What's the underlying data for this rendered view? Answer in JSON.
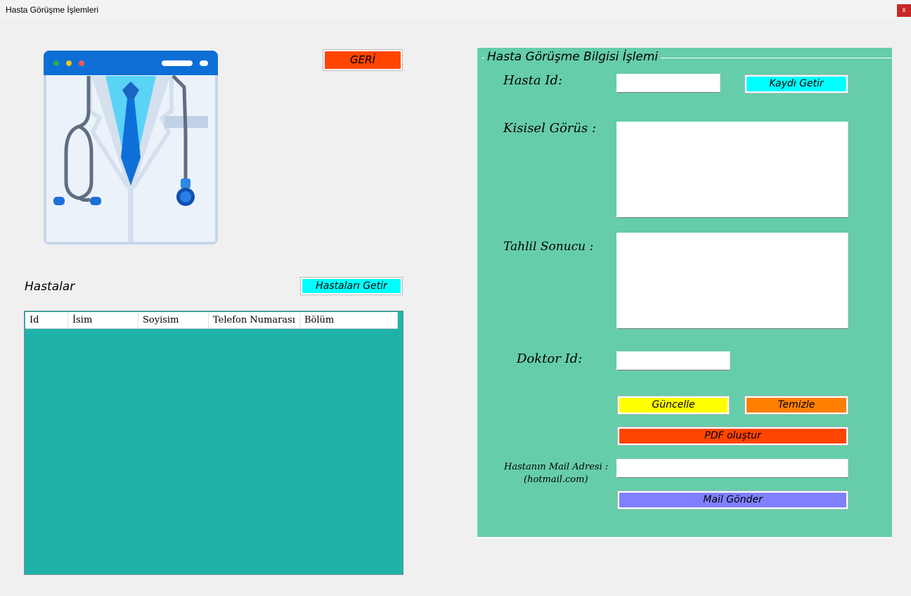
{
  "window": {
    "title": "Hasta Görüşme İşlemleri",
    "close_label": "x"
  },
  "left": {
    "back_button": "GERİ",
    "patients_heading": "Hastalar",
    "get_patients_button": "Hastaları Getir",
    "table": {
      "columns": [
        "Id",
        "İsim",
        "Soyisim",
        "Telefon Numarası",
        "Bölüm"
      ],
      "rows": []
    }
  },
  "form": {
    "legend": "Hasta Görüşme Bilgisi İşlemi",
    "patient_id_label": "Hasta Id:",
    "patient_id_value": "",
    "get_record_button": "Kaydı Getir",
    "personal_opinion_label": "Kisisel Görüs :",
    "personal_opinion_value": "",
    "analysis_result_label": "Tahlil Sonucu :",
    "analysis_result_value": "",
    "doctor_id_label": "Doktor Id:",
    "doctor_id_value": "",
    "update_button": "Güncelle",
    "clear_button": "Temizle",
    "pdf_button": "PDF oluştur",
    "mail_label_line1": "Hastanın Mail Adresi :",
    "mail_label_line2": "(hotmail.com)",
    "mail_value": "",
    "send_mail_button": "Mail Gönder"
  },
  "colors": {
    "form_background": "#66cdaa",
    "grid_background": "#20b2aa",
    "back_button": "#ff4500",
    "cyan_button": "#00ffff",
    "update_button": "#ffff00",
    "clear_button": "#ff7f00",
    "pdf_button": "#ff4500",
    "mail_button": "#8080ff"
  }
}
